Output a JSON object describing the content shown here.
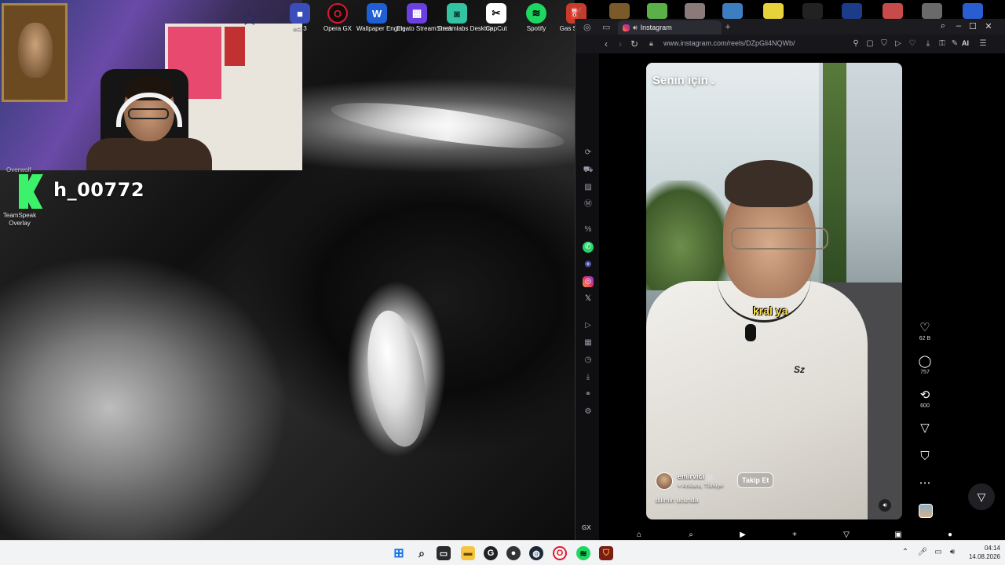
{
  "overlay": {
    "overwolf_label": "Overwolf",
    "kick_username": "h_00772",
    "teamspeak_label": "TeamSpeak Overlay"
  },
  "desktop_icons": [
    {
      "label": "ect 3",
      "icon": "app-icon",
      "color": "#3a4dbb"
    },
    {
      "label": "Opera GX",
      "icon": "opera-gx-icon",
      "color": "#e0182d"
    },
    {
      "label": "Wallpaper Engine",
      "icon": "wallpaper-engine-icon",
      "color": "#1f5fd6"
    },
    {
      "label": "Elgato Stream Deck",
      "icon": "stream-deck-icon",
      "color": "#6b3fe0"
    },
    {
      "label": "Streamlabs Desktop",
      "icon": "streamlabs-icon",
      "color": "#31c3a2"
    },
    {
      "label": "CapCut",
      "icon": "capcut-icon",
      "color": "#ffffff"
    },
    {
      "label": "Spotify",
      "icon": "spotify-icon",
      "color": "#1ed760"
    },
    {
      "label": "Gas S Simu",
      "icon": "gas-station-icon",
      "color": "#c83a2a"
    }
  ],
  "browser": {
    "tab_title": "Instagram",
    "url": "www.instagram.com/reels/DZpGli4NQWb/",
    "ai_label": "AI",
    "gx_label": "GX"
  },
  "reel": {
    "feed_title": "Senin için",
    "subtitle": "kral ya",
    "author": "emirvici",
    "location": "Ankara, Türkiye",
    "follow_label": "Takip Et",
    "caption": "dilimin ucunda",
    "shirt_logo": "Sz"
  },
  "actions": {
    "likes": "62 B",
    "comments": "757",
    "reposts": "600"
  },
  "taskbar": {
    "time": "04:14",
    "date": "14.08.2026"
  },
  "colors": {
    "kick_green": "#3df26b",
    "subtitle_yellow": "#ffe14a",
    "browser_bg": "#0f0f12"
  }
}
